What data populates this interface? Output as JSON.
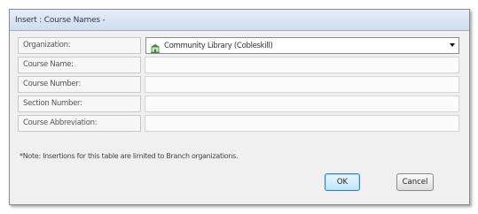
{
  "window": {
    "title": "Insert : Course Names -"
  },
  "form": {
    "organization": {
      "label": "Organization:",
      "value": "Community Library (Cobleskill)",
      "icon": "building-icon"
    },
    "fields": [
      {
        "label": "Course Name:",
        "value": ""
      },
      {
        "label": "Course Number:",
        "value": ""
      },
      {
        "label": "Section Number:",
        "value": ""
      },
      {
        "label": "Course Abbreviation:",
        "value": ""
      }
    ]
  },
  "note": "*Note: Insertions for this table are limited to Branch organizations.",
  "buttons": {
    "ok": "OK",
    "cancel": "Cancel"
  }
}
